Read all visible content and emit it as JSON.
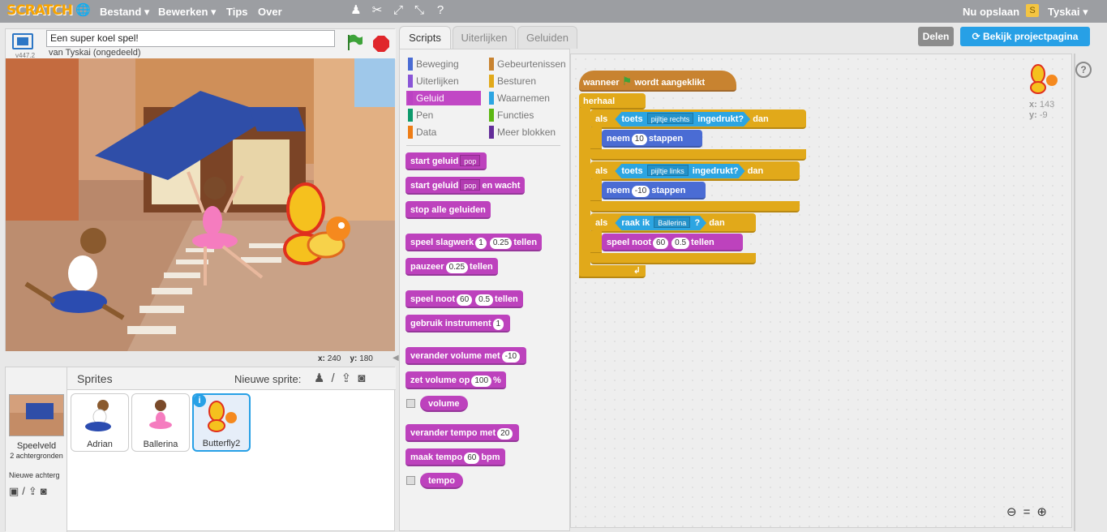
{
  "menubar": {
    "logo": "SCRATCH",
    "items": [
      "Bestand ▾",
      "Bewerken ▾",
      "Tips",
      "Over"
    ],
    "save": "Nu opslaan",
    "user": "Tyskai ▾"
  },
  "stage": {
    "title": "Een super koel spel!",
    "byline": "van Tyskai (ongedeeld)",
    "version": "v447.2",
    "x_label": "x:",
    "x_value": "240",
    "y_label": "y:",
    "y_value": "180"
  },
  "sprites": {
    "header": "Sprites",
    "new_sprite": "Nieuwe sprite:",
    "stage_label": "Speelveld",
    "backdrops": "2 achtergronden",
    "new_backdrop": "Nieuwe achterg",
    "items": [
      "Adrian",
      "Ballerina",
      "Butterfly2"
    ]
  },
  "tabs": [
    "Scripts",
    "Uiterlijken",
    "Geluiden"
  ],
  "header_buttons": {
    "share": "Delen",
    "project_page": "Bekijk projectpagina"
  },
  "categories": [
    {
      "label": "Beweging",
      "color": "#4a6cd4"
    },
    {
      "label": "Gebeurtenissen",
      "color": "#c88330"
    },
    {
      "label": "Uiterlijken",
      "color": "#8a55d7"
    },
    {
      "label": "Besturen",
      "color": "#e1a91a"
    },
    {
      "label": "Geluid",
      "color": "#bb42c3"
    },
    {
      "label": "Waarnemen",
      "color": "#2ca5e2"
    },
    {
      "label": "Pen",
      "color": "#0e9a6c"
    },
    {
      "label": "Functies",
      "color": "#5cb712"
    },
    {
      "label": "Data",
      "color": "#ee7d16"
    },
    {
      "label": "Meer blokken",
      "color": "#632d99"
    }
  ],
  "palette": {
    "b1": "start geluid",
    "b1d": "pop",
    "b2": "start geluid",
    "b2d": "pop",
    "b2b": "en wacht",
    "b3": "stop alle geluiden",
    "b4": "speel slagwerk",
    "b4d": "1",
    "b4v": "0.25",
    "b4b": "tellen",
    "b5": "pauzeer",
    "b5v": "0.25",
    "b5b": "tellen",
    "b6": "speel noot",
    "b6d": "60",
    "b6v": "0.5",
    "b6b": "tellen",
    "b7": "gebruik instrument",
    "b7d": "1",
    "b8": "verander volume met",
    "b8v": "-10",
    "b9": "zet volume op",
    "b9v": "100",
    "b9b": "%",
    "r1": "volume",
    "b10": "verander tempo met",
    "b10v": "20",
    "b11": "maak tempo",
    "b11v": "60",
    "b11b": "bpm",
    "r2": "tempo"
  },
  "script": {
    "hat1": "wanneer",
    "hat2": "wordt aangeklikt",
    "forever": "herhaal",
    "if1": "als",
    "if1_key": "toets",
    "if1_dd": "pijltje rechts",
    "if1_pressed": "ingedrukt?",
    "if1_then": "dan",
    "move1": "neem",
    "move1_v": "10",
    "move1_b": "stappen",
    "if2": "als",
    "if2_key": "toets",
    "if2_dd": "pijltje links",
    "if2_pressed": "ingedrukt?",
    "if2_then": "dan",
    "move2": "neem",
    "move2_v": "-10",
    "move2_b": "stappen",
    "if3": "als",
    "if3_touch": "raak ik",
    "if3_dd": "Ballerina",
    "if3_q": "?",
    "if3_then": "dan",
    "note": "speel noot",
    "note_d": "60",
    "note_v": "0.5",
    "note_b": "tellen",
    "pos_x_label": "x:",
    "pos_x": "143",
    "pos_y_label": "y:",
    "pos_y": "-9"
  }
}
